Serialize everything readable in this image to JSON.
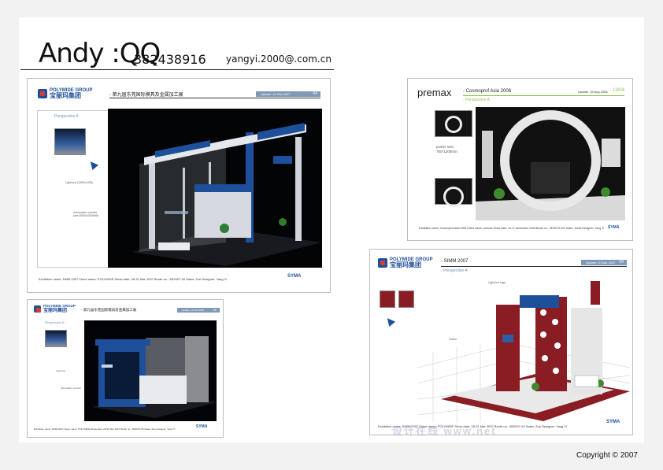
{
  "header": {
    "name": "Andy :QQ",
    "qq_number": "382438916",
    "email": "yangyi.2000@.com.cn"
  },
  "copyright": "Copyright © 2007",
  "watermark": "设计在线 www.net",
  "panels": [
    {
      "logo_en": "POLYMIDE GROUP",
      "logo_cn": "宝丽玛集团",
      "title": "- 第九届东莞国际模具及金属加工展",
      "page_tag": "Update: 10 Feb 2007",
      "page_number": "04",
      "perspective": "Perspective A",
      "label_light": "Light box (1000x1000)",
      "label_info": "Information counter size:2000x1000x900",
      "footer": "Exhibition name: DMM 2007    Client name: POLYMIDE    Show date: 28-31 Mar 2007    Booth no.: 3R2007-94    Sales: Zoe    Designer: Yang Yi",
      "brand": "SYMA"
    },
    {
      "logo_text": "premax",
      "title": "- Cosmoprof Asia 2006",
      "page_tag": "Update: 18 Aug 2006",
      "page_number": "13/04",
      "perspective": "- Perspective A",
      "poster_label": "poster size:",
      "poster_size": "750*1200mm",
      "footer": "Exhibition name: Cosmoprof Asia 2006    Client name: premax    Show date: 15-17 November 2006    Booth no.: 3E/007S-0/S    Sales: Justin    Designer: Yang Yi",
      "brand": "SYMA"
    },
    {
      "logo_en": "POLYMIDE GROUP",
      "logo_cn": "宝丽玛集团",
      "title": "- 第九届东莞国际模具及金属加工展",
      "page_tag": "Update: 10 Feb 2007",
      "page_number": "05",
      "perspective": "Perspective B",
      "label_light": "Light box",
      "label_info": "Information counter",
      "footer": "Exhibition name: DMM 2007    Client name: POLYMIDE    Show date: 28-31 Mar 2007    Booth no.: 3R2007-94    Sales: Zoe    Designer: Yang Yi",
      "brand": "SYMA"
    },
    {
      "logo_en": "POLYMIDE GROUP",
      "logo_cn": "宝丽玛集团",
      "title": "- SIMM 2007",
      "page_tag": "Update: 10 Mar 2007",
      "page_number": "04",
      "perspective": "- Perspective A",
      "label_light": "Light box logo",
      "label_frame": "Frame",
      "footer": "Exhibition name: SIMM 2007    Client name: POLYMIDE    Show date: 28-31 Mar 2007    Booth no.: 0B2007-94    Sales: Zoe    Designer: Yang Yi",
      "brand": "SYMA"
    }
  ],
  "colors": {
    "polymide_blue": "#1e4f9a",
    "booth_red": "#8a1c24",
    "tag_blue": "#7f9ab8"
  }
}
